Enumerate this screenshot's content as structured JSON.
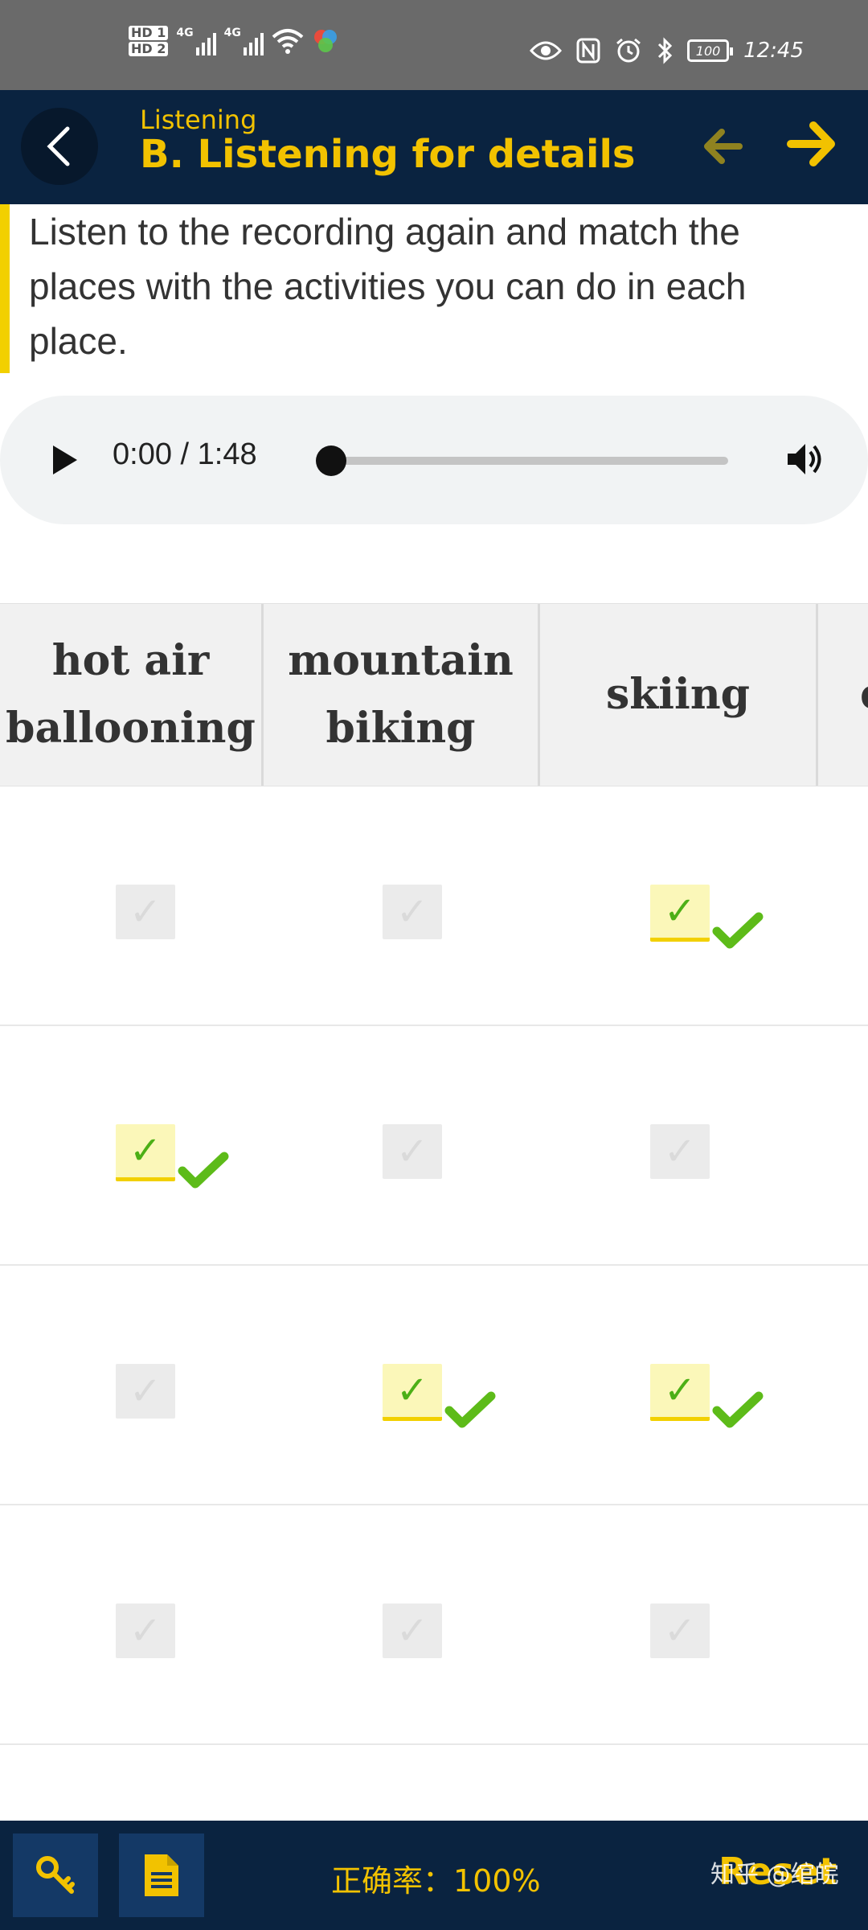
{
  "status_bar": {
    "hd_labels": [
      "HD 1",
      "HD 2"
    ],
    "network": [
      "4G",
      "4G"
    ],
    "battery": "100",
    "time": "12:45"
  },
  "header": {
    "subtitle": "Listening",
    "title": "B. Listening for details",
    "accent_color": "#f2c200",
    "background_color": "#0a2340"
  },
  "instruction": "Listen to the recording again and match the places with the activities you can do in each place.",
  "audio": {
    "time_display": "0:00 / 1:48",
    "progress": 0
  },
  "table": {
    "columns": [
      "hot air ballooning",
      "mountain biking",
      "skiing",
      "c"
    ],
    "rows": [
      {
        "checked": [
          false,
          false,
          true
        ],
        "correct": [
          false,
          false,
          true
        ]
      },
      {
        "checked": [
          true,
          false,
          false
        ],
        "correct": [
          true,
          false,
          false
        ]
      },
      {
        "checked": [
          false,
          true,
          true
        ],
        "correct": [
          false,
          true,
          true
        ]
      },
      {
        "checked": [
          false,
          false,
          false
        ],
        "correct": [
          false,
          false,
          false
        ]
      }
    ],
    "check_glyph": "✓"
  },
  "footer": {
    "accuracy": "正确率：100%",
    "reset_label": "Reset",
    "watermark": "知乎 @绾皖"
  }
}
